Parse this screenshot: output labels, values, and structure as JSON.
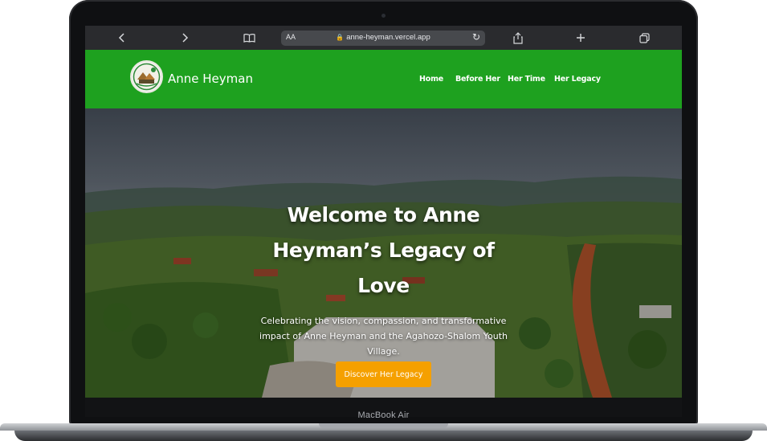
{
  "device": {
    "model_label": "MacBook Air"
  },
  "browser": {
    "text_size_label": "AA",
    "url": "anne-heyman.vercel.app",
    "icons": {
      "back": "chevron-left-icon",
      "forward": "chevron-right-icon",
      "reader": "book-icon",
      "lock": "lock-icon",
      "reload": "reload-icon",
      "share": "share-icon",
      "new_tab": "plus-icon",
      "tabs": "tabs-icon"
    }
  },
  "site": {
    "brand_color": "#1ea11f",
    "cta_color": "#f5a000",
    "title": "Anne Heyman",
    "nav": [
      "Home",
      "Before Her",
      "Her Time",
      "Her Legacy"
    ],
    "hero": {
      "heading": "Welcome to Anne Heyman’s Legacy of Love",
      "subheading": "Celebrating the vision, compassion, and transformative impact of Anne Heyman and the Agahozo-Shalom Youth Village.",
      "button_label": "Discover Her Legacy"
    }
  }
}
